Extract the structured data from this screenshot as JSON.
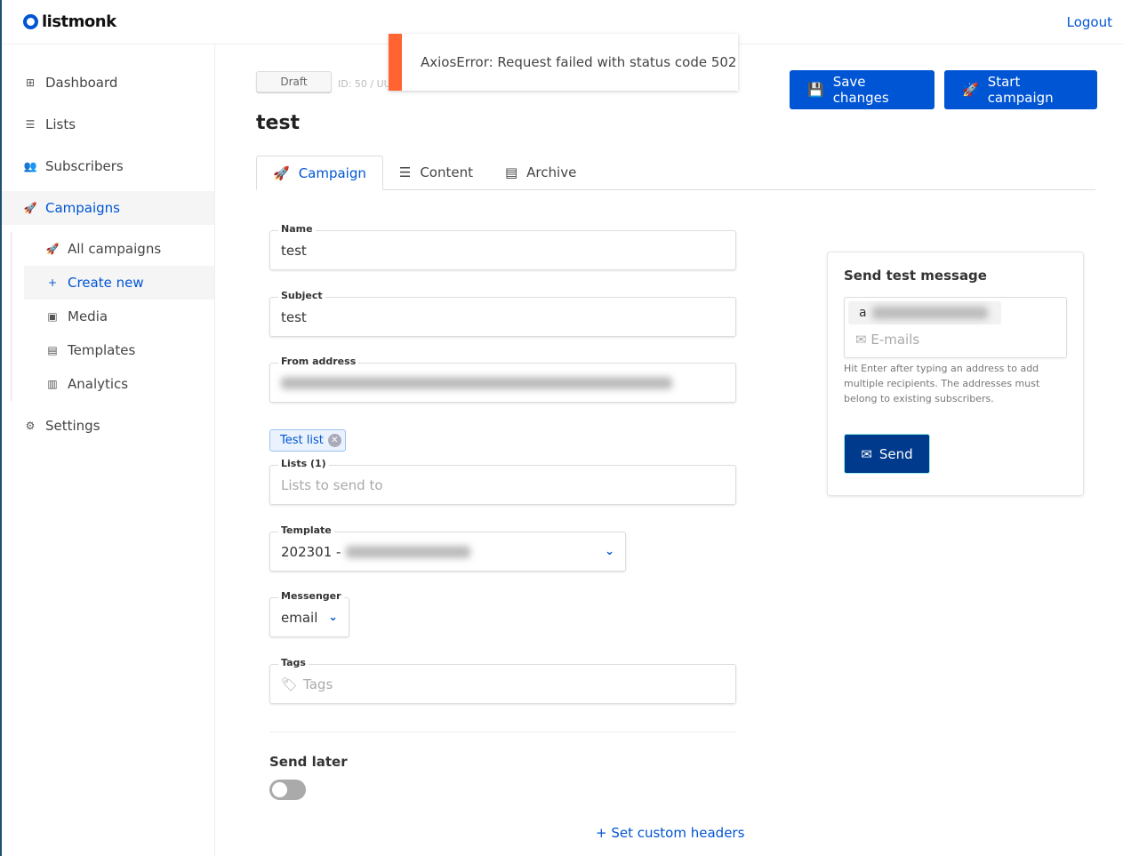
{
  "header": {
    "logo": "listmonk",
    "logout": "Logout"
  },
  "sidebar": {
    "items": [
      {
        "label": "Dashboard",
        "icon": "dashboard-icon"
      },
      {
        "label": "Lists",
        "icon": "list-icon"
      },
      {
        "label": "Subscribers",
        "icon": "users-icon"
      },
      {
        "label": "Campaigns",
        "icon": "rocket-icon"
      }
    ],
    "sub": [
      {
        "label": "All campaigns",
        "icon": "rocket-icon"
      },
      {
        "label": "Create new",
        "icon": "plus-icon"
      },
      {
        "label": "Media",
        "icon": "image-icon"
      },
      {
        "label": "Templates",
        "icon": "file-icon"
      },
      {
        "label": "Analytics",
        "icon": "chart-icon"
      }
    ],
    "settings": "Settings"
  },
  "campaign": {
    "status": "Draft",
    "id": "ID: 50 / UU",
    "title": "test"
  },
  "toolbar": {
    "save": "Save changes",
    "start": "Start campaign"
  },
  "tabs": [
    {
      "label": "Campaign"
    },
    {
      "label": "Content"
    },
    {
      "label": "Archive"
    }
  ],
  "form": {
    "name_label": "Name",
    "name": "test",
    "subject_label": "Subject",
    "subject": "test",
    "from_label": "From address",
    "list_tag": "Test list",
    "lists_label": "Lists (1)",
    "lists_placeholder": "Lists to send to",
    "template_label": "Template",
    "template": "202301 -",
    "messenger_label": "Messenger",
    "messenger": "email",
    "tags_label": "Tags",
    "tags_placeholder": "Tags",
    "send_later": "Send later",
    "send_later_on": false,
    "custom_headers": "+ Set custom headers"
  },
  "test": {
    "title": "Send test message",
    "chip_prefix": "a",
    "emails_placeholder": "E-mails",
    "help": "Hit Enter after typing an address to add multiple recipients. The addresses must belong to existing subscribers.",
    "send": "Send"
  },
  "toast": {
    "message": "AxiosError: Request failed with status code 502",
    "color": "#ff6432"
  },
  "colors": {
    "accent": "#0055d4",
    "send": "#003a8c"
  }
}
